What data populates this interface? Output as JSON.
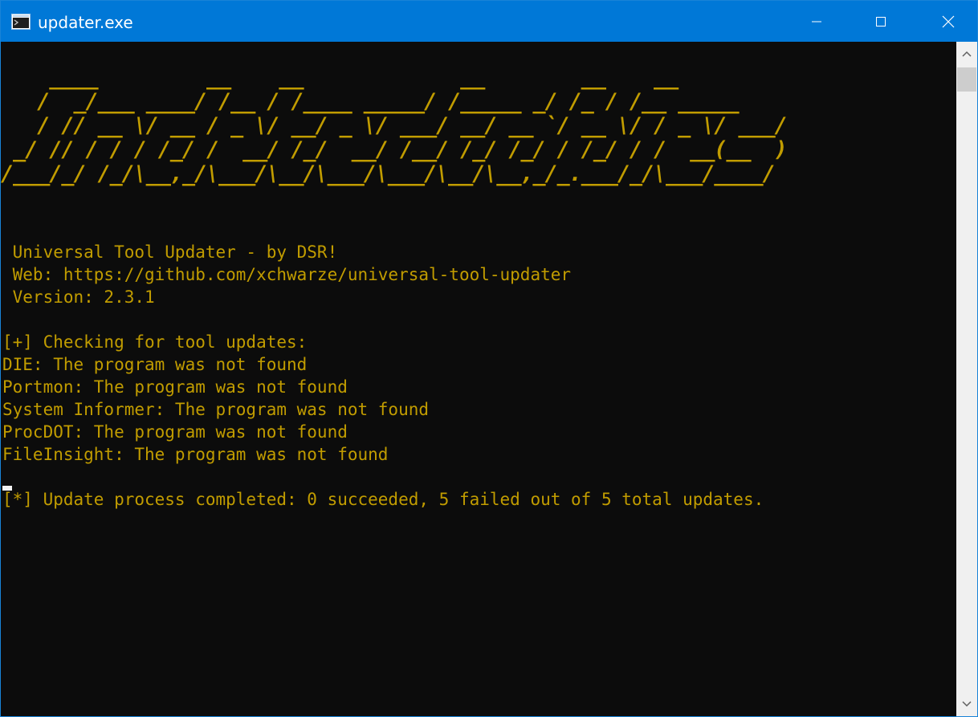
{
  "window": {
    "title": "updater.exe"
  },
  "banner": {
    "art_lines": [
      "    ____         __    __             __        __    __",
      "   /  _/___ ____/ /__ / /____ _____/ /_____ _/ /_ / /__ _____",
      "   / // __ \\/ __ / _ \\/ __/ _ \\/ ___/ __/ __ `/ __ \\/ / _ \\/ ___/",
      " _/ // / / / /_/ /  __/ /_/  __/ /__/ /_/ /_/ / /_/ / /  __(__  )",
      "/___/_/ /_/\\__,_/\\___/\\__/\\___/\\___/\\__/\\__,_/_.___/_/\\___/____/"
    ]
  },
  "output": {
    "lines": [
      " Universal Tool Updater - by DSR!",
      " Web: https://github.com/xchwarze/universal-tool-updater",
      " Version: 2.3.1",
      "",
      "[+] Checking for tool updates:",
      "DIE: The program was not found",
      "Portmon: The program was not found",
      "System Informer: The program was not found",
      "ProcDOT: The program was not found",
      "FileInsight: The program was not found",
      "",
      "[*] Update process completed: 0 succeeded, 5 failed out of 5 total updates."
    ]
  },
  "colors": {
    "titlebar": "#0078d7",
    "console_bg": "#0c0c0c",
    "console_text": "#c19c00"
  },
  "icons": {
    "app": "console-window-icon",
    "minimize": "minimize-icon",
    "maximize": "maximize-icon",
    "close": "close-icon"
  }
}
